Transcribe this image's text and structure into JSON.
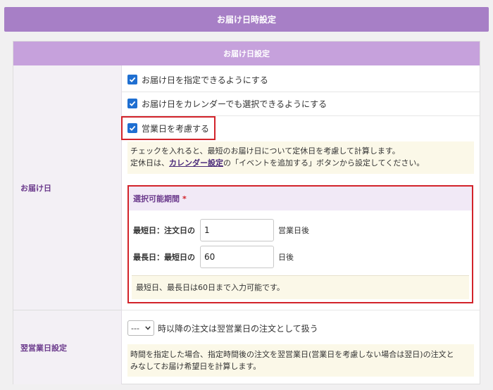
{
  "header": {
    "title": "お届け日時設定"
  },
  "panel": {
    "title": "お届け日設定"
  },
  "delivery": {
    "label": "お届け日",
    "options": [
      {
        "label": "お届け日を指定できるようにする",
        "checked": true
      },
      {
        "label": "お届け日をカレンダーでも選択できるようにする",
        "checked": true
      },
      {
        "label": "営業日を考慮する",
        "checked": true
      }
    ],
    "note_line1": "チェックを入れると、最短のお届け日について定休日を考慮して計算します。",
    "note_line2_pre": "定休日は、",
    "note_line2_link": "カレンダー設定",
    "note_line2_post": "の「イベントを追加する」ボタンから設定してください。",
    "period": {
      "title": "選択可能期間",
      "required_mark": "*",
      "min_label": "最短日：注文日の",
      "min_value": "1",
      "min_unit": "営業日後",
      "max_label": "最長日：最短日の",
      "max_value": "60",
      "max_unit": "日後",
      "note": "最短日、最長日は60日まで入力可能です。"
    }
  },
  "next_day": {
    "label": "翌営業日設定",
    "select_value": "---",
    "select_suffix": "時以降の注文は翌営業日の注文として扱う",
    "note_line1": "時間を指定した場合、指定時間後の注文を翌営業日(営業日を考慮しない場合は翌日)の注文と",
    "note_line2": "みなしてお届け希望日を計算します。"
  },
  "colors": {
    "header_bg": "#a77fc6",
    "panel_header_bg": "#c6a1dc",
    "checkbox": "#1f6fd1",
    "highlight": "#d2232a",
    "note_bg": "#fbf8e8"
  }
}
